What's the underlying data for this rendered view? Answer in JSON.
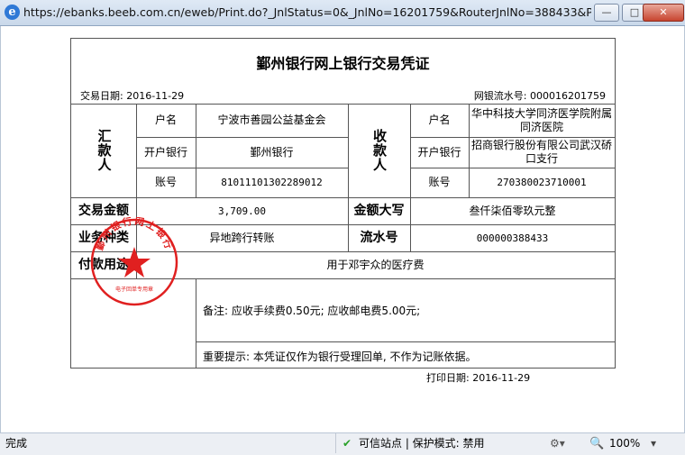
{
  "window": {
    "url": "https://ebanks.beeb.com.cn/eweb/Print.do?_JnlStatus=0&_JnlNo=16201759&RouterJnlNo=388433&PayerA...",
    "min_label": "—",
    "max_label": "□",
    "close_label": "✕"
  },
  "receipt": {
    "title": "鄞州银行网上银行交易凭证",
    "trade_date": "交易日期: 2016-11-29",
    "serial_no": "网银流水号: 000016201759",
    "payer": {
      "section_label": "汇款人",
      "name_label": "户名",
      "name": "宁波市善园公益基金会",
      "bank_label": "开户银行",
      "bank": "鄞州银行",
      "account_label": "账号",
      "account": "81011101302289012"
    },
    "payee": {
      "section_label": "收款人",
      "name_label": "户名",
      "name": "华中科技大学同济医学院附属同济医院",
      "bank_label": "开户银行",
      "bank": "招商银行股份有限公司武汉硚口支行",
      "account_label": "账号",
      "account": "270380023710001"
    },
    "amount_label": "交易金额",
    "amount": "3,709.00",
    "amount_upper_label": "金额大写",
    "amount_upper": "叁仟柒佰零玖元整",
    "business_type_label": "业务种类",
    "business_type": "异地跨行转账",
    "flow_no_label": "流水号",
    "flow_no": "000000388433",
    "purpose_label": "付款用途",
    "purpose": "用于邓宇众的医疗费",
    "remark": "备注:  应收手续费0.50元; 应收邮电费5.00元;",
    "important": "重要提示: 本凭证仅作为银行受理回单, 不作为记账依据。",
    "seal": {
      "arc_text": "鄞州银行网上银行",
      "bottom_text": "电子回单专用章",
      "color": "#e02020"
    },
    "print_date": "打印日期: 2016-11-29"
  },
  "status": {
    "left": "完成",
    "trusted": "可信站点 | 保护模式: 禁用",
    "zoom": "100%"
  }
}
